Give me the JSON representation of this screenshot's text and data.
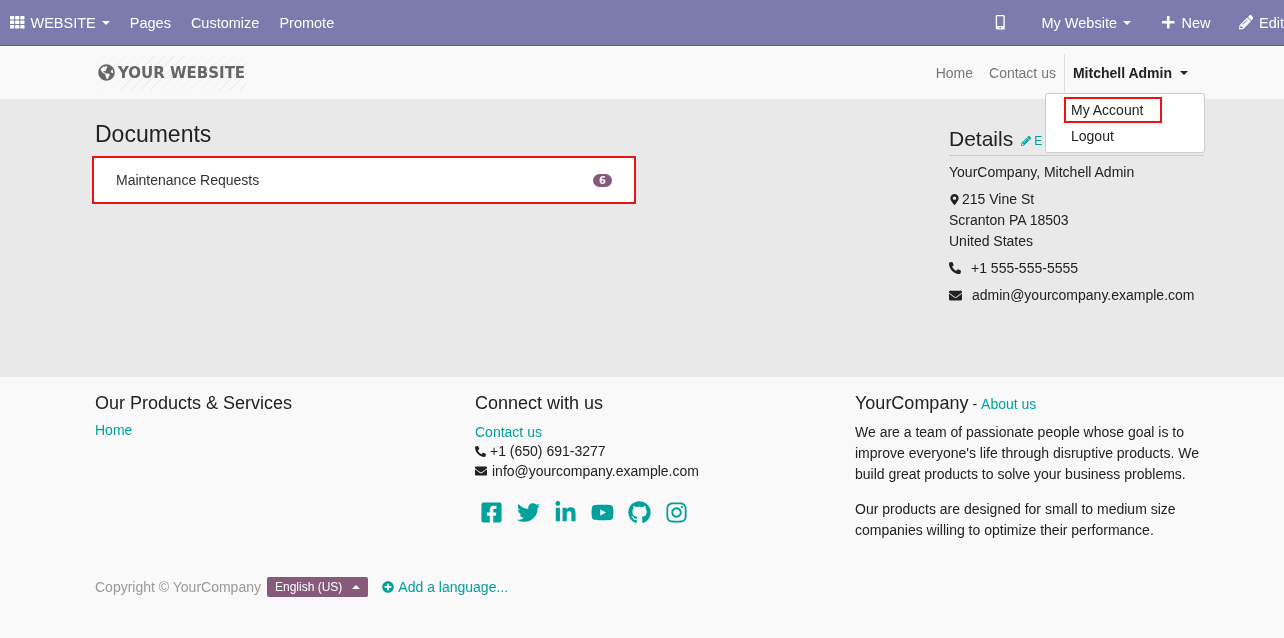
{
  "editor_bar": {
    "app_menu": "WEBSITE",
    "menus": [
      "Pages",
      "Customize",
      "Promote"
    ],
    "site_menu": "My Website",
    "new_button": "New",
    "edit_button": "Edit"
  },
  "header": {
    "logo": "YOUR WEBSITE",
    "nav": [
      {
        "label": "Home"
      },
      {
        "label": "Contact us"
      }
    ],
    "user": "Mitchell Admin",
    "user_menu": {
      "items": [
        {
          "label": "My Account",
          "highlighted": true
        },
        {
          "label": "Logout",
          "highlighted": false
        }
      ]
    }
  },
  "documents": {
    "title": "Documents",
    "items": [
      {
        "label": "Maintenance Requests",
        "count": "6",
        "highlighted": true
      }
    ]
  },
  "details": {
    "title": "Details",
    "edit_link": "E",
    "name": "YourCompany, Mitchell Admin",
    "address": [
      "215 Vine St",
      "Scranton PA 18503",
      "United States"
    ],
    "phone": "+1 555-555-5555",
    "email": "admin@yourcompany.example.com"
  },
  "footer": {
    "products": {
      "title": "Our Products & Services",
      "links": [
        "Home"
      ]
    },
    "connect": {
      "title": "Connect with us",
      "link": "Contact us",
      "phone": "+1 (650) 691-3277",
      "email": "info@yourcompany.example.com"
    },
    "about": {
      "title": "YourCompany",
      "separator": "-",
      "link": "About us",
      "paragraphs": [
        "We are a team of passionate people whose goal is to improve everyone's life through disruptive products. We build great products to solve your business problems.",
        "Our products are designed for small to medium size companies willing to optimize their performance."
      ]
    },
    "copyright": "Copyright © YourCompany",
    "language": "English (US)",
    "add_language": "Add a language..."
  }
}
